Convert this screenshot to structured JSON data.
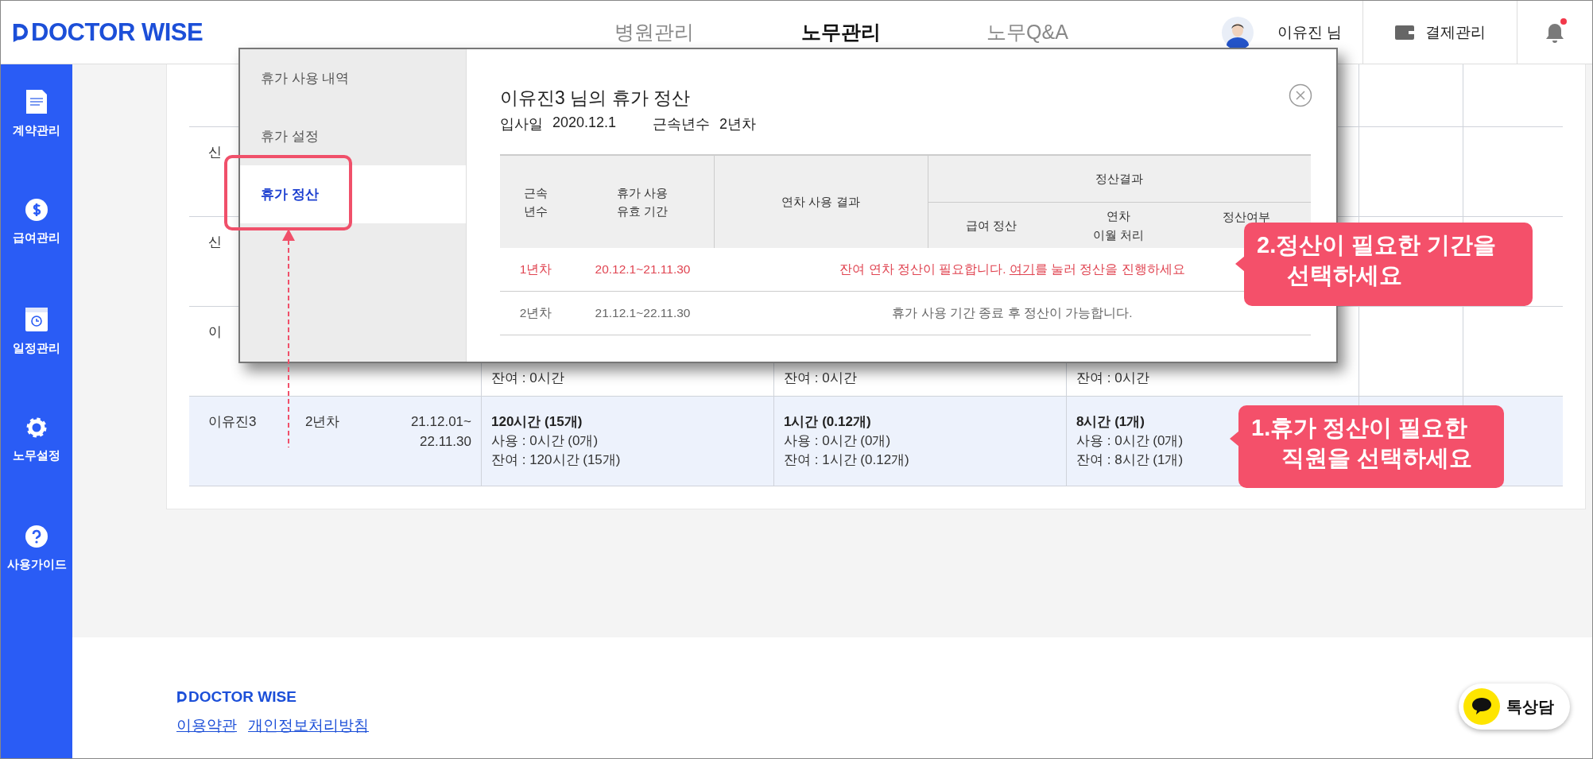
{
  "header": {
    "logo": "DOCTOR WISE",
    "nav": [
      {
        "label": "병원관리",
        "selected": false
      },
      {
        "label": "노무관리",
        "selected": true
      },
      {
        "label": "노무Q&A",
        "selected": false
      }
    ],
    "user_name": "이유진 님",
    "billing": "결제관리",
    "notification_dot": true
  },
  "sidebar": {
    "items": [
      {
        "label": "계약관리",
        "kind": "contract"
      },
      {
        "label": "급여관리",
        "kind": "salary"
      },
      {
        "label": "일정관리",
        "kind": "schedule"
      },
      {
        "label": "노무설정",
        "kind": "settings"
      },
      {
        "label": "사용가이드",
        "kind": "guide"
      }
    ]
  },
  "employee_table": {
    "rows": [
      {
        "name": "",
        "selected": false
      },
      {
        "name": "신",
        "selected": false
      },
      {
        "name": "신",
        "selected": false
      },
      {
        "name": "이",
        "selected": false,
        "cells": [
          {
            "remaining": "잔여 : 0시간"
          },
          {
            "remaining": "잔여 : 0시간"
          },
          {
            "remaining": "잔여 : 0시간"
          }
        ]
      },
      {
        "name": "이유진3",
        "years": "2년차",
        "period": [
          "21.12.01~",
          "22.11.30"
        ],
        "selected": true,
        "cells": [
          {
            "total": "120시간 (15개)",
            "used": "사용 : 0시간 (0개)",
            "remaining": "잔여 : 120시간 (15개)"
          },
          {
            "total": "1시간 (0.12개)",
            "used": "사용 : 0시간 (0개)",
            "remaining": "잔여 : 1시간 (0.12개)"
          },
          {
            "total": "8시간 (1개)",
            "used": "사용 : 0시간 (0개)",
            "remaining": "잔여 : 8시간 (1개)"
          }
        ]
      }
    ]
  },
  "modal": {
    "menu": [
      {
        "label": "휴가 사용 내역",
        "selected": false
      },
      {
        "label": "휴가 설정",
        "selected": false
      },
      {
        "label": "휴가 정산",
        "selected": true
      }
    ],
    "title": "이유진3 님의 휴가 정산",
    "hire_label": "입사일",
    "hire_date": "2020.12.1",
    "tenure_label": "근속년수",
    "tenure": "2년차",
    "columns": {
      "tenure": "근속\n년수",
      "period": "휴가 사용\n유효 기간",
      "result": "연차 사용 결과",
      "settlement": "정산결과",
      "settlement_sub": [
        "급여 정산",
        "연차\n이월 처리",
        "정산여부"
      ]
    },
    "rows": [
      {
        "kind": "action",
        "year": "1년차",
        "period": "20.12.1~21.11.30",
        "message_before": "잔여 연차 정산이 필요합니다. ",
        "link": "여기",
        "message_after": "를 눌러 정산을 진행하세요"
      },
      {
        "kind": "info",
        "year": "2년차",
        "period": "21.12.1~22.11.30",
        "message_before": "휴가 사용 기간 종료 후 정산이 가능합니다."
      }
    ]
  },
  "callouts": [
    {
      "text": "2.정산이 필요한 기간을\n선택하세요"
    },
    {
      "text": "1.휴가 정산이 필요한\n직원을 선택하세요"
    }
  ],
  "footer": {
    "logo": "DOCTOR WISE",
    "links": [
      "이용약관",
      "개인정보처리방침"
    ],
    "chat": "톡상담"
  }
}
